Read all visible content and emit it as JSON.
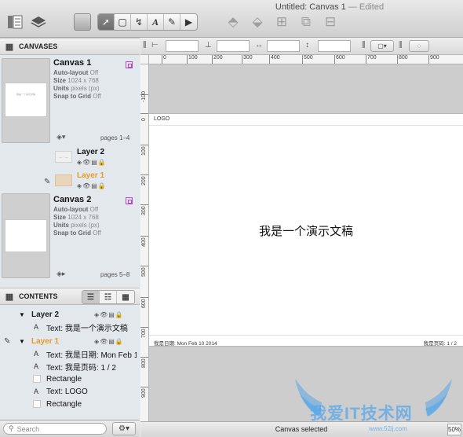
{
  "window": {
    "title": "Untitled: Canvas 1",
    "edited": "— Edited"
  },
  "toolbar": {
    "icons": [
      "canvases-list-icon",
      "layers-icon",
      "style-brush-icon",
      "selection-tool-icon",
      "shape-tool-icon",
      "line-tool-icon",
      "text-tool-icon",
      "pen-tool-icon",
      "browse-tool-icon",
      "bring-forward-icon",
      "send-backward-icon",
      "group-icon",
      "ungroup-icon",
      "align-icon"
    ]
  },
  "sidebar": {
    "canvases_header": "CANVASES",
    "canvases": [
      {
        "name": "Canvas 1",
        "meta": [
          {
            "key": "Auto-layout",
            "value": "Off"
          },
          {
            "key": "Size",
            "value": "1024 x 768"
          },
          {
            "key": "Units",
            "value": "pixels (px)"
          },
          {
            "key": "Snap to Grid",
            "value": "Off"
          }
        ],
        "pages": "pages 1–4",
        "thumb_text": "我是一个演示文稿"
      },
      {
        "name": "Canvas 2",
        "meta": [
          {
            "key": "Auto-layout",
            "value": "Off"
          },
          {
            "key": "Size",
            "value": "1024 x 768"
          },
          {
            "key": "Units",
            "value": "pixels (px)"
          },
          {
            "key": "Snap to Grid",
            "value": "Off"
          }
        ],
        "pages": "pages 5–8"
      }
    ],
    "layers": [
      {
        "name": "Layer 2",
        "thumb_text": "— · —"
      },
      {
        "name": "Layer 1",
        "thumb_text": ""
      }
    ],
    "contents_header": "CONTENTS",
    "contents_tree": {
      "layer2": "Layer 2",
      "layer2_items": [
        {
          "kind": "A",
          "text": "Text: 我是一个演示文稿"
        }
      ],
      "layer1": "Layer 1",
      "layer1_items": [
        {
          "kind": "A",
          "text": "Text: 我是日期:  Mon Feb 10 2014"
        },
        {
          "kind": "A",
          "text": "Text: 我是页码:  1 / 2"
        },
        {
          "kind": "swatch",
          "text": "Rectangle"
        },
        {
          "kind": "A",
          "text": "Text: LOGO"
        },
        {
          "kind": "swatch",
          "text": "Rectangle"
        }
      ]
    },
    "search_placeholder": "Search"
  },
  "inspector": {
    "fields": [
      "",
      "",
      "",
      ""
    ]
  },
  "rulers": {
    "top": [
      "0",
      "100",
      "200",
      "300",
      "400",
      "500",
      "600",
      "700",
      "800",
      "900"
    ],
    "left": [
      "-100",
      "0",
      "100",
      "200",
      "300",
      "400",
      "500",
      "600",
      "700",
      "800",
      "900"
    ]
  },
  "document": {
    "logo": "LOGO",
    "title": "我是一个演示文稿",
    "date": "我是日期:   Mon Feb 10 2014",
    "page_number": "我是页码:  1 / 2"
  },
  "status": {
    "text": "Canvas selected",
    "zoom": "50%"
  },
  "watermark": {
    "text": "我爱IT技术网",
    "url": "www.52ij.com"
  },
  "colors": {
    "layer1_accent": "#E89A2C",
    "canvas_mark": "#B04AC8",
    "watermark": "#5BA8E8"
  }
}
